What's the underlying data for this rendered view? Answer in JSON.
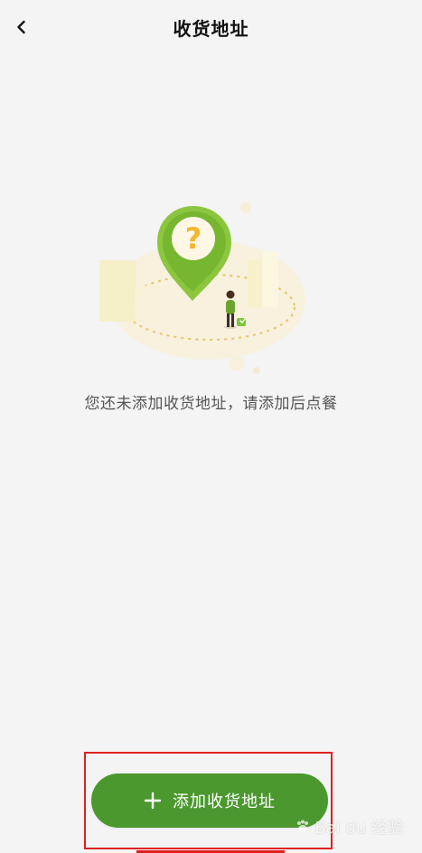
{
  "header": {
    "title": "收货地址"
  },
  "empty_state": {
    "illustration_icon": "location-question-icon",
    "message": "您还未添加收货地址，请添加后点餐"
  },
  "actions": {
    "add_address_label": "添加收货地址",
    "add_address_icon": "plus-icon"
  },
  "watermark": {
    "text": "Bai du 经验"
  },
  "colors": {
    "background": "#f4f4f4",
    "primary_button": "#4b982e",
    "highlight_border": "#e02020",
    "pin_green": "#8cc63f",
    "question_mark": "#f2b62f"
  }
}
